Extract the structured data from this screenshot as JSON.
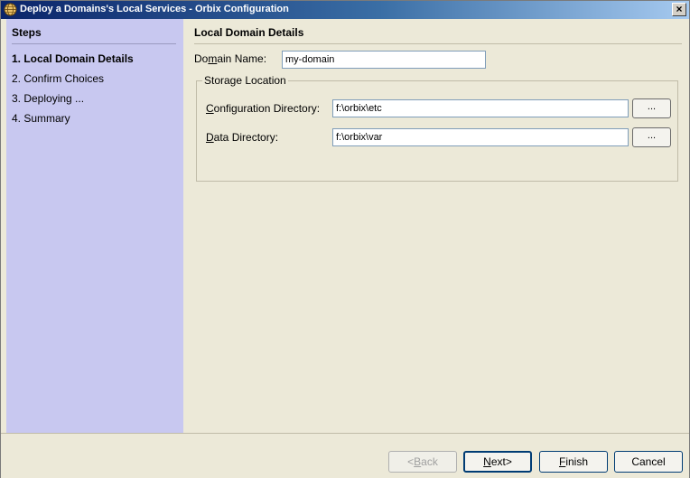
{
  "window": {
    "title": "Deploy a Domains's Local Services - Orbix Configuration",
    "close_label": "×"
  },
  "steps": {
    "header": "Steps",
    "items": [
      {
        "label": "1. Local Domain Details",
        "current": true
      },
      {
        "label": "2. Confirm Choices",
        "current": false
      },
      {
        "label": "3. Deploying ...",
        "current": false
      },
      {
        "label": "4. Summary",
        "current": false
      }
    ]
  },
  "main": {
    "header": "Local Domain Details",
    "domain_name": {
      "label_pre": "Do",
      "label_mnemonic": "m",
      "label_post": "ain Name:",
      "value": "my-domain"
    },
    "storage": {
      "legend": "Storage Location",
      "config_dir": {
        "label_mnemonic": "C",
        "label_post": "onfiguration Directory:",
        "value": "f:\\orbix\\etc",
        "browse_label": "..."
      },
      "data_dir": {
        "label_mnemonic": "D",
        "label_post": "ata Directory:",
        "value": "f:\\orbix\\var",
        "browse_label": "..."
      }
    }
  },
  "footer": {
    "back": {
      "pre": "<",
      "mnemonic": "B",
      "post": "ack"
    },
    "next": {
      "mnemonic": "N",
      "post": "ext>"
    },
    "finish": {
      "mnemonic": "F",
      "post": "inish"
    },
    "cancel": "Cancel"
  },
  "colors": {
    "steps_panel_bg": "#c8c8f0",
    "title_bar_start": "#0a246a",
    "title_bar_end": "#a6caf0",
    "dialog_bg": "#ece9d8"
  }
}
